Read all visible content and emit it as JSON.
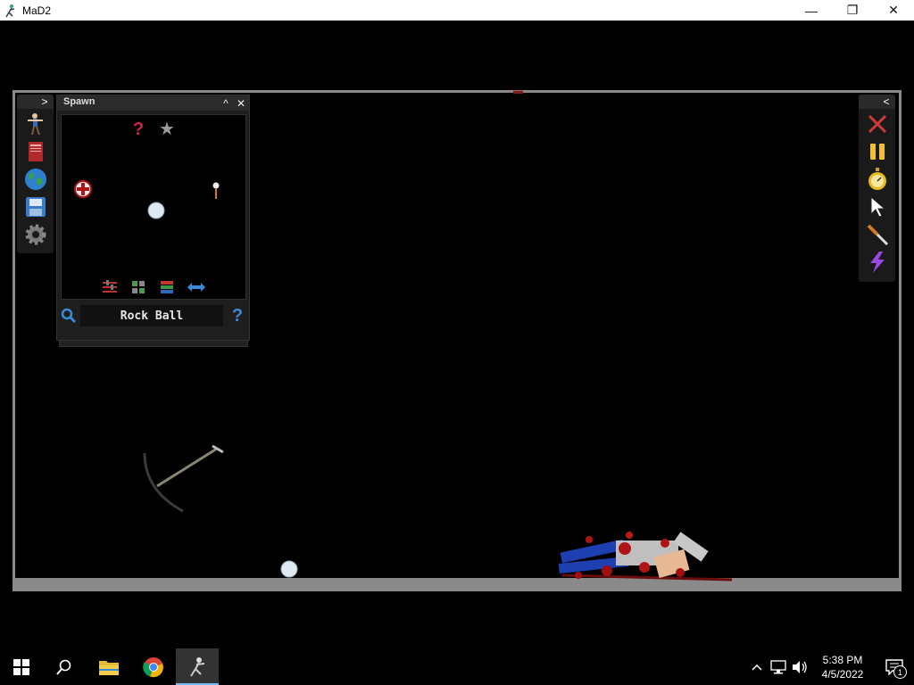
{
  "window": {
    "title": "MaD2",
    "controls": {
      "minimize": "—",
      "maximize": "❐",
      "close": "✕"
    }
  },
  "left_toolbar": {
    "toggle_glyph": ">",
    "tools": [
      {
        "name": "character-tool-icon"
      },
      {
        "name": "book-icon"
      },
      {
        "name": "globe-icon"
      },
      {
        "name": "save-icon"
      },
      {
        "name": "settings-gear-icon"
      }
    ]
  },
  "spawn_panel": {
    "title": "Spawn",
    "collapse_glyph": "^",
    "close_glyph": "✕",
    "top_icons": [
      {
        "name": "random-question-icon",
        "glyph": "?",
        "color": "#d2214a"
      },
      {
        "name": "favorite-star-icon",
        "glyph": "★",
        "color": "#9a9a9a"
      }
    ],
    "items": [
      {
        "name": "first-aid-ball-icon"
      },
      {
        "name": "rock-ball-icon"
      },
      {
        "name": "match-pin-icon"
      }
    ],
    "filter_icons": [
      {
        "name": "sliders-icon"
      },
      {
        "name": "grid-view-icon"
      },
      {
        "name": "list-view-icon"
      },
      {
        "name": "swap-arrows-icon"
      }
    ],
    "search": {
      "value": "Rock Ball"
    },
    "help_glyph": "?"
  },
  "right_toolbar": {
    "toggle_glyph": "<",
    "tools": [
      {
        "name": "delete-x-icon"
      },
      {
        "name": "pause-icon"
      },
      {
        "name": "stopwatch-icon"
      },
      {
        "name": "cursor-icon"
      },
      {
        "name": "knife-icon"
      },
      {
        "name": "lightning-icon"
      }
    ]
  },
  "taskbar": {
    "apps": [
      {
        "name": "start-button"
      },
      {
        "name": "search-button"
      },
      {
        "name": "file-explorer-button"
      },
      {
        "name": "chrome-button"
      },
      {
        "name": "mad2-taskbar-button",
        "active": true
      }
    ],
    "clock": {
      "time": "5:38 PM",
      "date": "4/5/2022"
    },
    "notification_count": "1"
  },
  "colors": {
    "frame_gray": "#8a8a8a",
    "accent_blue": "#76b9ed",
    "blood_red": "#b01515",
    "ragdoll_blue": "#1d3fb0"
  }
}
